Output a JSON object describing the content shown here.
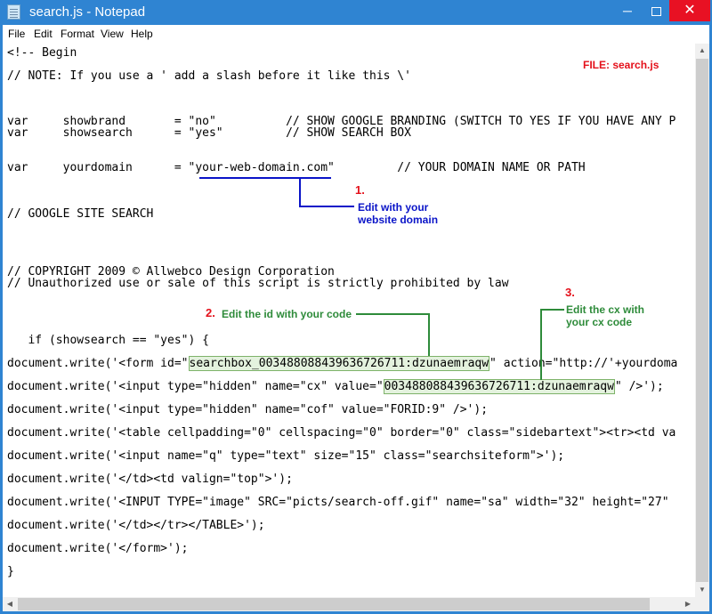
{
  "window": {
    "title": "search.js - Notepad",
    "controls": {
      "minimize": "─",
      "close": "✕"
    }
  },
  "menu": [
    "File",
    "Edit",
    "Format",
    "View",
    "Help"
  ],
  "code": {
    "l1": "<!-- Begin",
    "l2": "// NOTE: If you use a ' add a slash before it like this \\'",
    "l3": "var     showbrand       = \"no\"          // SHOW GOOGLE BRANDING (SWITCH TO YES IF YOU HAVE ANY P",
    "l4": "var     showsearch      = \"yes\"         // SHOW SEARCH BOX",
    "l5": "var     yourdomain      = \"your-web-domain.com\"         // YOUR DOMAIN NAME OR PATH",
    "l6": "// GOOGLE SITE SEARCH",
    "l7": "// COPYRIGHT 2009 © Allwebco Design Corporation",
    "l8": "// Unauthorized use or sale of this script is strictly prohibited by law",
    "l9": "   if (showsearch == \"yes\") {",
    "l10_a": "document.write('<form id=\"",
    "l10_b": "searchbox_003488088439636726711:dzunaemraqw",
    "l10_c": "\" action=\"http://'+yourdoma",
    "l11_a": "document.write('<input type=\"hidden\" name=\"cx\" value=\"",
    "l11_b": "003488088439636726711:dzunaemraqw",
    "l11_c": "\" />');",
    "l12": "document.write('<input type=\"hidden\" name=\"cof\" value=\"FORID:9\" />');",
    "l13": "document.write('<table cellpadding=\"0\" cellspacing=\"0\" border=\"0\" class=\"sidebartext\"><tr><td va",
    "l14": "document.write('<input name=\"q\" type=\"text\" size=\"15\" class=\"searchsiteform\">');",
    "l15": "document.write('</td><td valign=\"top\">');",
    "l16": "document.write('<INPUT TYPE=\"image\" SRC=\"picts/search-off.gif\" name=\"sa\" width=\"32\" height=\"27\"",
    "l17": "document.write('</td></tr></TABLE>');",
    "l18": "document.write('</form>');",
    "l19": "}"
  },
  "annotations": {
    "file_label": "FILE: search.js",
    "a1_num": "1.",
    "a1_line1": "Edit with your",
    "a1_line2": "website domain",
    "a2_num": "2.",
    "a2_text": "Edit the id with your code",
    "a3_num": "3.",
    "a3_line1": "Edit the cx with",
    "a3_line2": "your cx code"
  },
  "colors": {
    "titlebar": "#2f84d2",
    "close_button": "#e81123",
    "annotation_red": "#e4101a",
    "annotation_blue": "#0a14c8",
    "annotation_green": "#2e8b3a",
    "highlight_fill": "#e4f2de"
  }
}
